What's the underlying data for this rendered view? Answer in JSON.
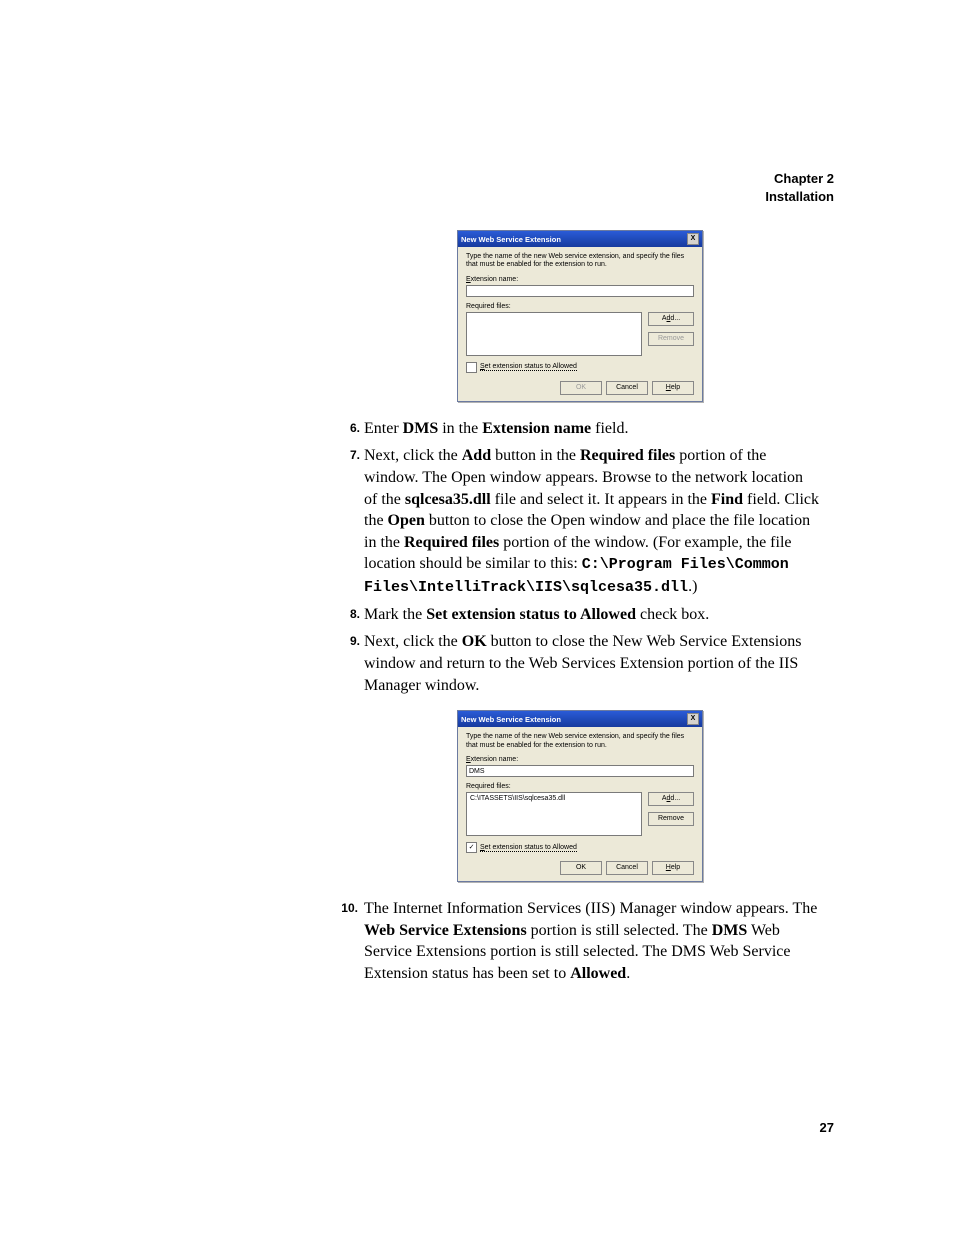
{
  "header": {
    "chapter": "Chapter 2",
    "section": "Installation"
  },
  "dialog1": {
    "title": "New Web Service Extension",
    "close": "X",
    "intro": "Type the name of the new Web service extension, and specify the files that must be enabled for the extension to run.",
    "ext_label": "Extension name:",
    "ext_value": "",
    "req_label": "Required files:",
    "list_value": "",
    "add": "Add...",
    "remove": "Remove",
    "chk_checked": "",
    "chk_label": "Set extension status to Allowed",
    "ok": "OK",
    "cancel": "Cancel",
    "help": "Help"
  },
  "dialog2": {
    "title": "New Web Service Extension",
    "close": "X",
    "intro": "Type the name of the new Web service extension, and specify the files that must be enabled for the extension to run.",
    "ext_label": "Extension name:",
    "ext_value": "DMS",
    "req_label": "Required files:",
    "list_value": "C:\\ITASSETS\\IIS\\sqlcesa35.dll",
    "add": "Add...",
    "remove": "Remove",
    "chk_checked": "✓",
    "chk_label": "Set extension status to Allowed",
    "ok": "OK",
    "cancel": "Cancel",
    "help": "Help"
  },
  "steps": {
    "s6": {
      "t1": "Enter ",
      "b1": "DMS",
      "t2": " in the ",
      "b2": "Extension name",
      "t3": " field."
    },
    "s7": {
      "t1": "Next, click the ",
      "b1": "Add",
      "t2": " button in the ",
      "b2": "Required files",
      "t3": " portion of the window. The Open window appears. Browse to the network location of the ",
      "b3": "sqlcesa35.dll",
      "t4": " file and select it. It appears in the ",
      "b4": "Find",
      "t5": " field. Click the ",
      "b5": "Open",
      "t6": " button to close the Open window and place the file location in the ",
      "b6": "Required files",
      "t7": " portion of the window. (For example, the file location should be similar to this: ",
      "m1": "C:\\Program Files\\Common Files\\IntelliTrack\\IIS\\sqlcesa35.dll",
      "t8": ".)"
    },
    "s8": {
      "t1": "Mark the ",
      "b1": "Set extension status to Allowed",
      "t2": " check box."
    },
    "s9": {
      "t1": "Next, click the ",
      "b1": "OK",
      "t2": " button to close the New Web Service Extensions window and return to the Web Services Extension portion of the IIS Manager window."
    },
    "s10": {
      "t1": "The Internet Information Services (IIS) Manager window appears. The ",
      "b1": "Web Service Extensions",
      "t2": " portion is still selected. The ",
      "b2": "DMS",
      "t3": " Web Service Extensions portion is still selected. The DMS Web Service Extension status has been set to ",
      "b3": "Allowed",
      "t4": "."
    }
  },
  "pagenum": "27"
}
